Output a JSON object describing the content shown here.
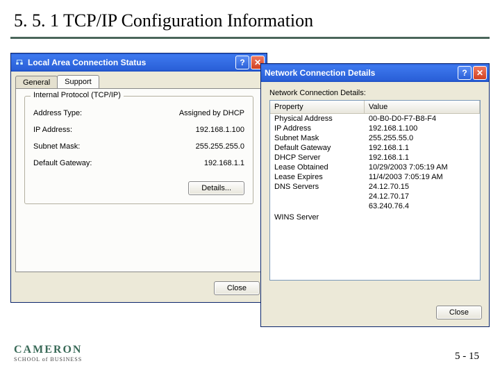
{
  "slide": {
    "title": "5. 5. 1  TCP/IP Configuration Information",
    "page_number": "5 - 15"
  },
  "logo": {
    "main": "CAMERON",
    "sub": "SCHOOL of BUSINESS"
  },
  "status_window": {
    "title": "Local Area Connection Status",
    "help_label": "?",
    "close_label": "✕",
    "tabs": {
      "general": "General",
      "support": "Support"
    },
    "group_legend": "Internal Protocol (TCP/IP)",
    "rows": [
      {
        "label": "Address Type:",
        "value": "Assigned by DHCP"
      },
      {
        "label": "IP Address:",
        "value": "192.168.1.100"
      },
      {
        "label": "Subnet Mask:",
        "value": "255.255.255.0"
      },
      {
        "label": "Default Gateway:",
        "value": "192.168.1.1"
      }
    ],
    "details_btn": "Details...",
    "close_btn": "Close"
  },
  "details_window": {
    "title": "Network Connection Details",
    "help_label": "?",
    "close_label": "✕",
    "caption": "Network Connection Details:",
    "headers": {
      "property": "Property",
      "value": "Value"
    },
    "rows": [
      {
        "property": "Physical Address",
        "value": "00-B0-D0-F7-B8-F4"
      },
      {
        "property": "IP Address",
        "value": "192.168.1.100"
      },
      {
        "property": "Subnet Mask",
        "value": "255.255.55.0"
      },
      {
        "property": "Default Gateway",
        "value": "192.168.1.1"
      },
      {
        "property": "DHCP Server",
        "value": "192.168.1.1"
      },
      {
        "property": "Lease Obtained",
        "value": "10/29/2003 7:05:19 AM"
      },
      {
        "property": "Lease Expires",
        "value": "11/4/2003 7:05:19 AM"
      },
      {
        "property": "DNS Servers",
        "value": "24.12.70.15"
      },
      {
        "property": "",
        "value": "24.12.70.17"
      },
      {
        "property": "",
        "value": "63.240.76.4"
      },
      {
        "property": "",
        "value": ""
      },
      {
        "property": "WINS Server",
        "value": ""
      }
    ],
    "close_btn": "Close"
  }
}
